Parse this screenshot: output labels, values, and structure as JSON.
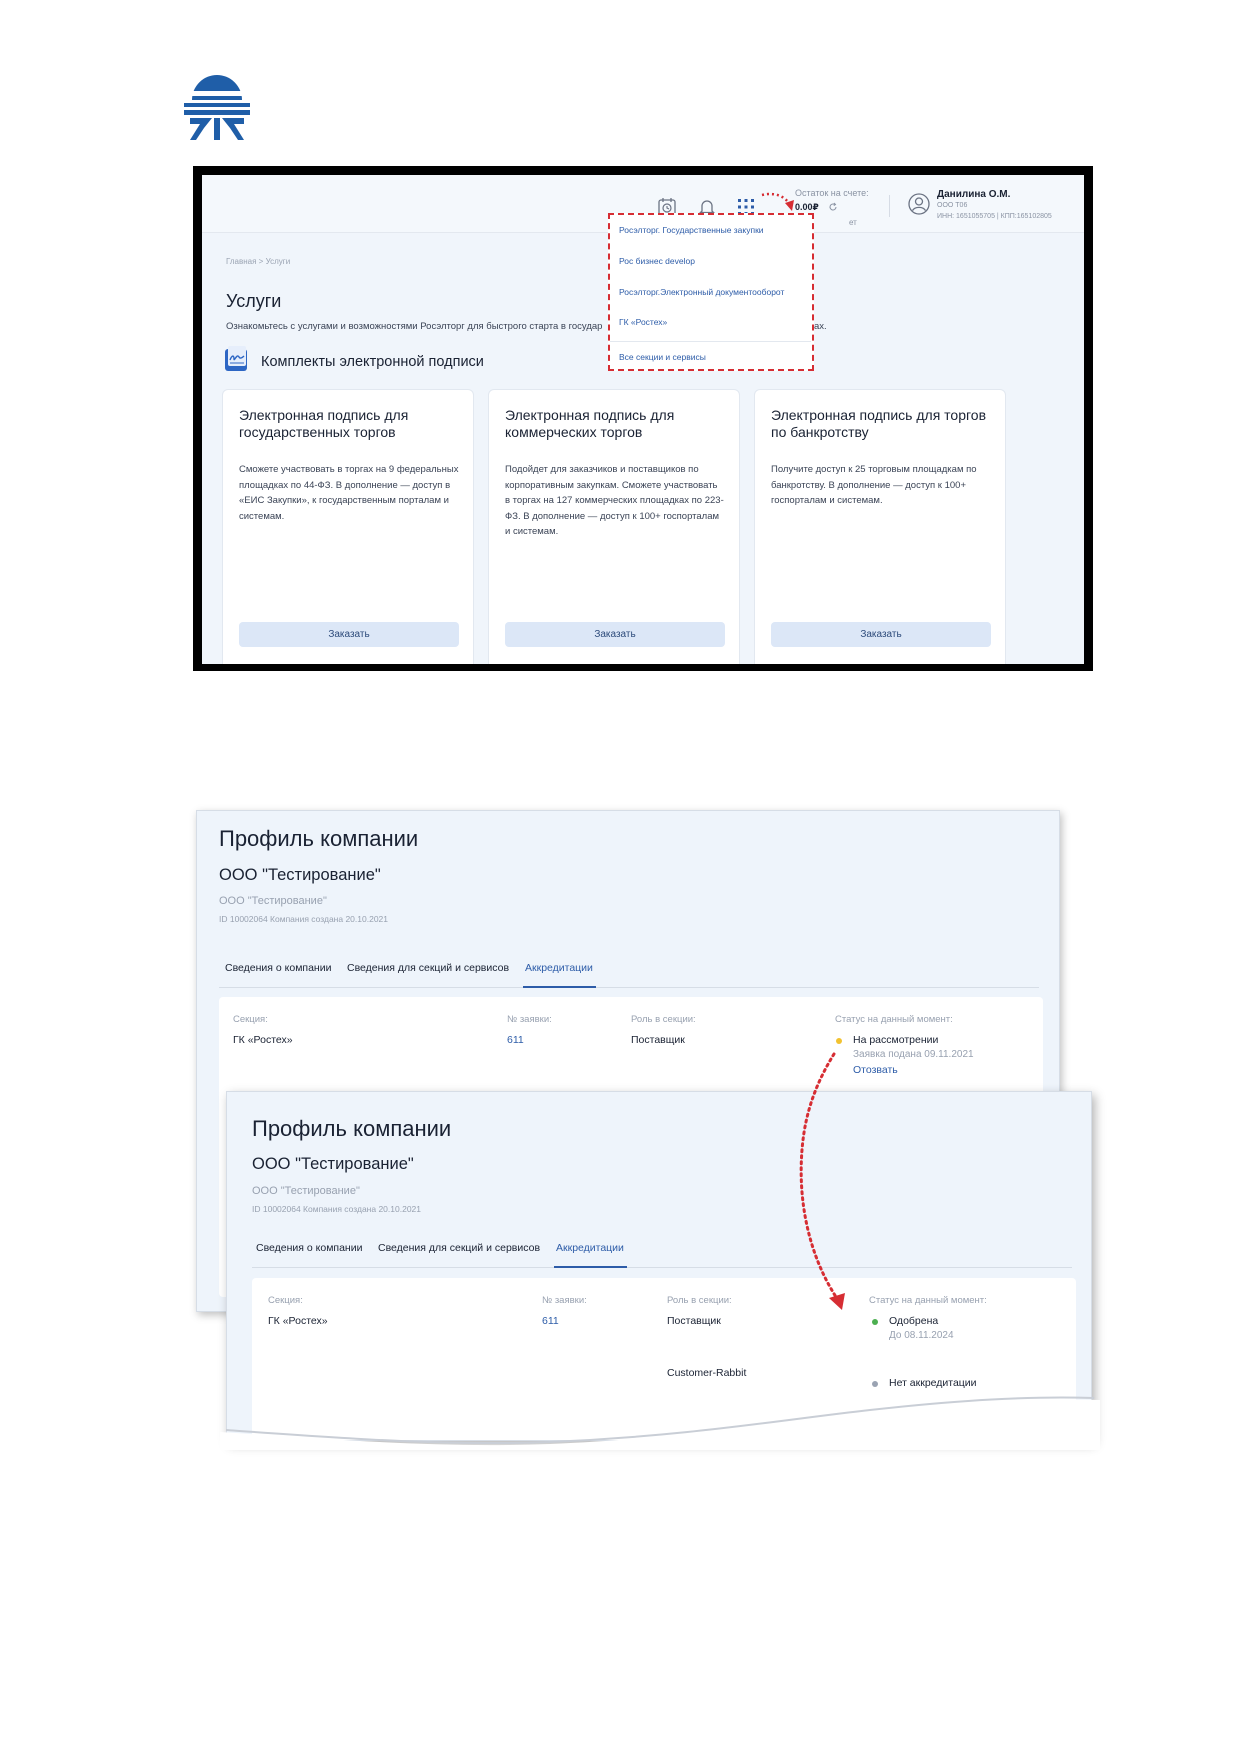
{
  "screenshot1": {
    "header": {
      "balance_label": "Остаток на счете:",
      "balance_value": "0.00₽",
      "balance_tail": "ет",
      "user_name": "Данилина О.М.",
      "user_org": "ООО Т06",
      "user_inn": "ИНН: 1651055705 | КПП:165102805"
    },
    "dropdown": {
      "items": [
        "Росэлторг. Государственные закупки",
        "Рос бизнес develop",
        "Росэлторг.Электронный документооборот",
        "ГК «Ростех»"
      ],
      "all_link": "Все секции и сервисы"
    },
    "breadcrumb": "Главная  >  Услуги",
    "title": "Услуги",
    "intro": "Ознакомьтесь с услугами и возможностями Росэлторг для быстрого старта в государ",
    "intro_tail": "ах.",
    "section_title": "Комплекты электронной подписи",
    "cards": [
      {
        "title": "Электронная подпись для государственных торгов",
        "text": "Сможете участвовать в торгах на 9 федеральных площадках по 44-ФЗ. В дополнение — доступ в «ЕИС Закупки», к государственным порталам и системам.",
        "button": "Заказать"
      },
      {
        "title": "Электронная подпись для коммерческих торгов",
        "text": "Подойдет для заказчиков и поставщиков по корпоративным закупкам. Сможете участвовать в торгах на 127 коммерческих площадках по 223-ФЗ. В дополнение — доступ к 100+ госпорталам и системам.",
        "button": "Заказать"
      },
      {
        "title": "Электронная подпись для торгов по банкротству",
        "text": "Получите доступ к 25 торговым площадкам по банкротству. В дополнение — доступ к 100+ госпорталам и системам.",
        "button": "Заказать"
      }
    ]
  },
  "screenshot2": {
    "title": "Профиль компании",
    "company": "ООО \"Тестирование\"",
    "company_sub": "ООО \"Тестирование\"",
    "meta": "ID 10002064    Компания создана 20.10.2021",
    "tabs": [
      "Сведения о компании",
      "Сведения для секций и сервисов",
      "Аккредитации"
    ],
    "columns": [
      "Секция:",
      "№ заявки:",
      "Роль в секции:",
      "Статус на данный момент:"
    ],
    "row": {
      "section": "ГК «Ростех»",
      "number": "611",
      "role": "Поставщик",
      "status": "На рассмотрении",
      "status_note": "Заявка подана 09.11.2021",
      "action": "Отозвать"
    },
    "status_color": "#f2c230"
  },
  "screenshot3": {
    "title": "Профиль компании",
    "company": "ООО \"Тестирование\"",
    "company_sub": "ООО \"Тестирование\"",
    "meta": "ID 10002064    Компания создана 20.10.2021",
    "tabs": [
      "Сведения о компании",
      "Сведения для секций и сервисов",
      "Аккредитации"
    ],
    "columns": [
      "Секция:",
      "№ заявки:",
      "Роль в секции:",
      "Статус на данный момент:"
    ],
    "row": {
      "section": "ГК «Ростех»",
      "number": "611",
      "role": "Поставщик",
      "status": "Одобрена",
      "status_note": "До 08.11.2024"
    },
    "row2": {
      "role": "Customer-Rabbit",
      "status": "Нет аккредитации"
    },
    "status_color": "#4caf50",
    "status2_color": "#9aa3b2"
  },
  "annotation_color": "#d62d33"
}
